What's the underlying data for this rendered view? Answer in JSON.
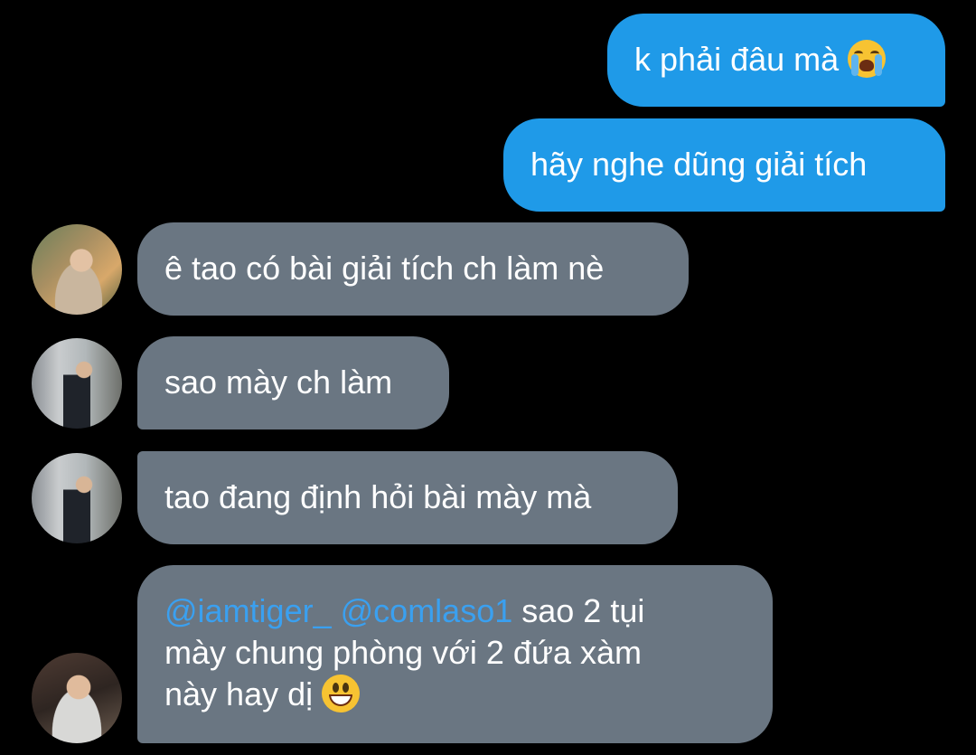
{
  "messages": [
    {
      "side": "out",
      "text": "k phải đâu mà",
      "emoji": "loudly-crying-face-emoji"
    },
    {
      "side": "out",
      "text": "hãy nghe dũng giải tích"
    },
    {
      "side": "in",
      "avatar": "avatar-1",
      "text": "ê tao có bài giải tích ch làm nè"
    },
    {
      "side": "in",
      "avatar": "avatar-2",
      "text": "sao mày ch làm"
    },
    {
      "side": "in",
      "avatar": "avatar-2",
      "text": "tao đang định hỏi bài mày mà"
    },
    {
      "side": "in",
      "avatar": "avatar-3",
      "mention1": "@iamtiger_",
      "mention2": "@comlaso1",
      "text_part1": "sao 2 tụi",
      "text_line2": "mày chung phòng với 2 đứa xàm",
      "text_line3": "này hay dị",
      "emoji": "grinning-face-emoji"
    }
  ],
  "colors": {
    "background": "#000000",
    "outgoing_bubble": "#1f9ae8",
    "incoming_bubble": "#6a7682",
    "mention": "#3aa0f0",
    "text": "#ffffff"
  }
}
